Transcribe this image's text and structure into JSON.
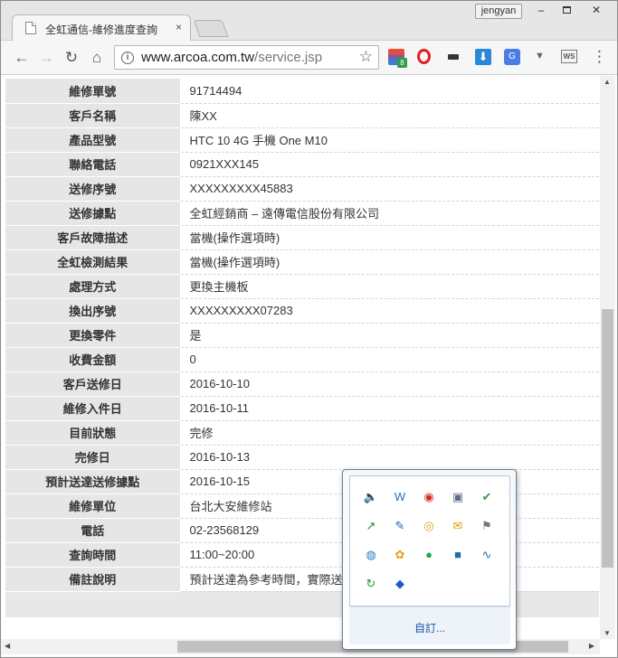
{
  "browser": {
    "tab_title": "全虹通信-維修進度查詢",
    "tab_close": "×",
    "profile_name": "jengyan",
    "url_host": "www.arcoa.com.tw",
    "url_path": "/service.jsp",
    "info_glyph": "i",
    "extension_badge": "8",
    "translate_glyph": "G",
    "download_glyph": "⬇",
    "ws_glyph": "WS"
  },
  "window_controls": {
    "minimize": "–",
    "close": "✕"
  },
  "nav": {
    "back": "←",
    "forward": "→",
    "reload": "↻",
    "home": "⌂",
    "bookmark_star": "☆",
    "menu": "⋮"
  },
  "details": {
    "rows": [
      {
        "label": "維修單號",
        "value": "91714494"
      },
      {
        "label": "客戶名稱",
        "value": "陳XX"
      },
      {
        "label": "產品型號",
        "value": "HTC 10 4G 手機 One M10"
      },
      {
        "label": "聯絡電話",
        "value": "0921XXX145"
      },
      {
        "label": "送修序號",
        "value": "XXXXXXXXX45883"
      },
      {
        "label": "送修據點",
        "value": "全虹經銷商 – 遠傳電信股份有限公司"
      },
      {
        "label": "客戶故障描述",
        "value": "當機(操作選項時)"
      },
      {
        "label": "全虹檢測結果",
        "value": "當機(操作選項時)"
      },
      {
        "label": "處理方式",
        "value": "更換主機板"
      },
      {
        "label": "換出序號",
        "value": "XXXXXXXXX07283"
      },
      {
        "label": "更換零件",
        "value": "是"
      },
      {
        "label": "收費金額",
        "value": "0"
      },
      {
        "label": "客戶送修日",
        "value": "2016-10-10"
      },
      {
        "label": "維修入件日",
        "value": "2016-10-11"
      },
      {
        "label": "目前狀態",
        "value": "完修"
      },
      {
        "label": "完修日",
        "value": "2016-10-13"
      },
      {
        "label": "預計送達送修據點",
        "value": "2016-10-15"
      },
      {
        "label": "維修單位",
        "value": "台北大安維修站"
      },
      {
        "label": "電話",
        "value": "02-23568129"
      },
      {
        "label": "查詢時間",
        "value": "11:00~20:00"
      },
      {
        "label": "備註說明",
        "value": "預計送達為參考時間，實際送達"
      }
    ]
  },
  "tray": {
    "customize_label": "自訂...",
    "icons": [
      "sound-settings-icon",
      "wifi-app-icon",
      "red-app-icon",
      "network-error-icon",
      "check-shield-icon",
      "green-chart-icon",
      "blue-tool-icon",
      "orange-o-icon",
      "mail-icon",
      "flag-icon",
      "globe-icon",
      "paint-icon",
      "line-chat-icon",
      "cloud-sync-icon",
      "pulse-icon",
      "green-sync-icon",
      "blue-diamond-icon"
    ]
  },
  "scroll": {
    "up": "▲",
    "down": "▼",
    "left": "◀",
    "right": "▶"
  }
}
